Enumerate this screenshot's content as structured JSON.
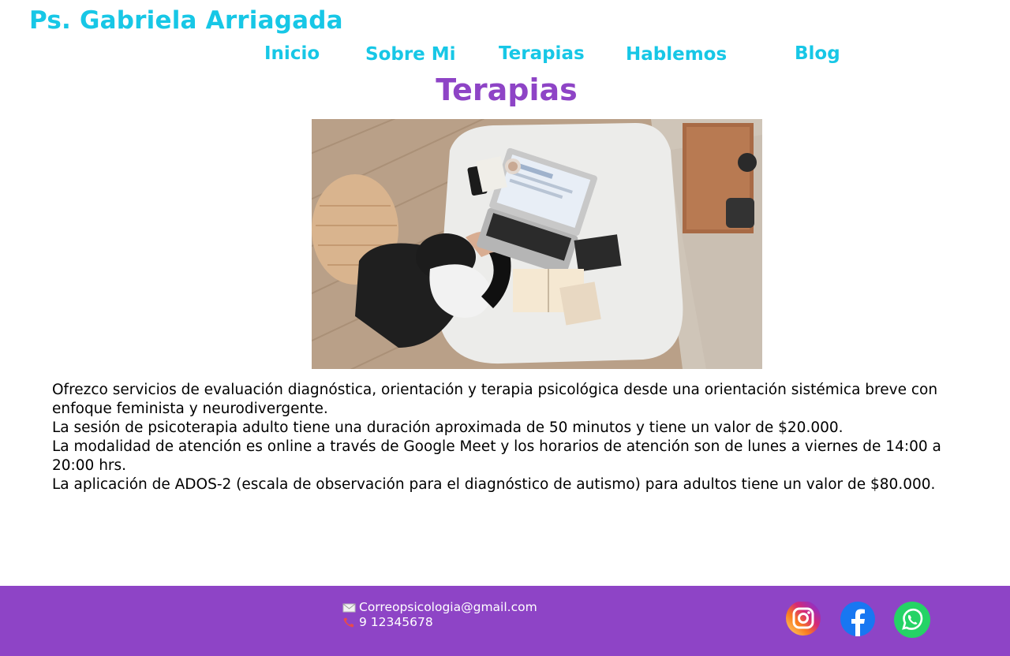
{
  "site": {
    "title": "Ps. Gabriela Arriagada"
  },
  "nav": {
    "items": [
      {
        "label": "Inicio"
      },
      {
        "label": "Sobre Mi"
      },
      {
        "label": "Terapias"
      },
      {
        "label": "Hablemos"
      },
      {
        "label": "Blog"
      }
    ]
  },
  "main": {
    "title": "Terapias",
    "paragraphs": [
      "Ofrezco servicios de evaluación diagnóstica, orientación y terapia psicológica desde una orientación sistémica breve con enfoque feminista y neurodivergente.",
      "La sesión de psicoterapia adulto tiene una duración aproximada de 50 minutos y tiene un valor de $20.000.",
      "La modalidad de atención es online a través de Google Meet y los horarios de atención son de lunes a viernes de 14:00 a 20:00 hrs.",
      "La aplicación de ADOS-2 (escala de observación para el diagnóstico de autismo) para adultos tiene un valor de $80.000."
    ]
  },
  "footer": {
    "email": "Correopsicologia@gmail.com",
    "phone": "9 12345678",
    "email_icon": "envelope-icon",
    "phone_icon": "phone-icon",
    "social": [
      "instagram-icon",
      "facebook-icon",
      "whatsapp-icon"
    ],
    "colors": {
      "background": "#8e44c6",
      "facebook": "#1877f2",
      "whatsapp": "#25d366"
    }
  },
  "colors": {
    "brand_cyan": "#17c7e6",
    "accent_purple": "#8e44c6"
  }
}
